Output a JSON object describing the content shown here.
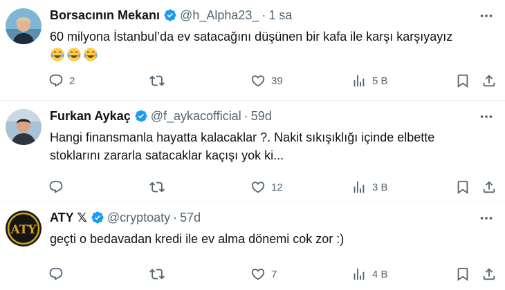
{
  "tweets": [
    {
      "name": "Borsacının Mekanı",
      "handle": "@h_Alpha23_",
      "separator": "·",
      "time": "1 sa",
      "text_lines": [
        "60 milyona İstanbul’da ev satacağını düşünen bir kafa ile karşı karşıyayız"
      ],
      "emoji_count": 3,
      "avatar": "person-portrait",
      "replies": "2",
      "retweets": "",
      "likes": "39",
      "views": "5 B"
    },
    {
      "name": "Furkan Aykaç",
      "handle": "@f_aykacofficial",
      "separator": "·",
      "time": "59d",
      "text_lines": [
        "Hangi finansmanla hayatta kalacaklar ?. Nakit sıkışıklığı içinde elbette",
        "stoklarını zararla satacaklar kaçışı yok ki..."
      ],
      "emoji_count": 0,
      "avatar": "person-portrait",
      "replies": "",
      "retweets": "",
      "likes": "12",
      "views": "3 B"
    },
    {
      "name": "ATY 𝕏",
      "handle": "@cryptoaty",
      "separator": "·",
      "time": "57d",
      "text_lines": [
        "geçti o bedavadan kredi ile ev alma dönemi cok zor :)"
      ],
      "emoji_count": 0,
      "avatar": "aty-logo",
      "avatar_text": "ATY",
      "replies": "",
      "retweets": "",
      "likes": "7",
      "views": "4 B"
    }
  ],
  "colors": {
    "verified": "#1d9bf0",
    "muted": "#536471",
    "text": "#0f1419",
    "divider": "#eff3f4"
  }
}
